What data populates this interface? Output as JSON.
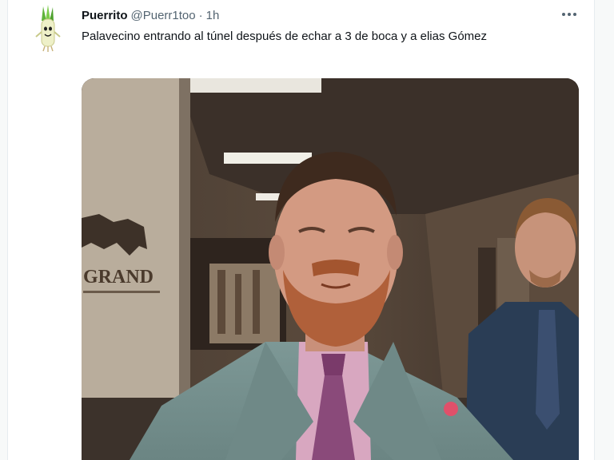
{
  "tweet": {
    "display_name": "Puerrito",
    "handle": "@Puerr1too",
    "separator": "·",
    "time": "1h",
    "text": "Palavecino entrando al túnel después de echar a 3 de boca y a elias Gómez",
    "more_icon": "more-horizontal-icon",
    "avatar_icon": "leek-character-icon"
  },
  "media": {
    "type": "video-still",
    "wall_logo_text": "GRAND"
  },
  "colors": {
    "name": "#0f1419",
    "secondary": "#536471",
    "rail": "#f7f9f9"
  }
}
